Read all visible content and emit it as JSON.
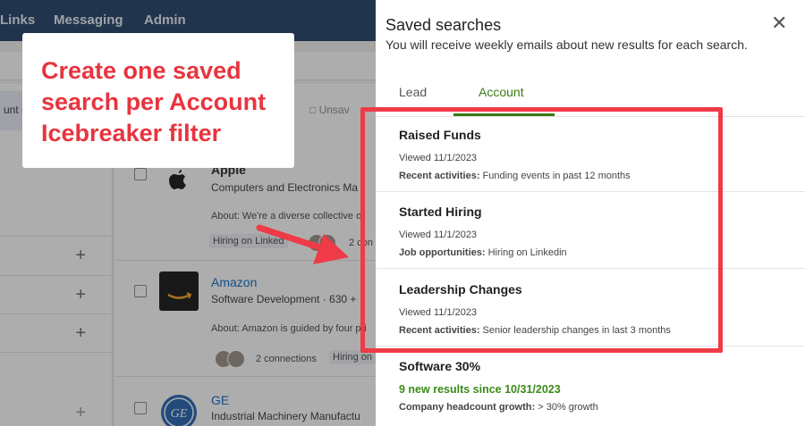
{
  "nav": {
    "items": [
      "Links",
      "Messaging",
      "Admin"
    ]
  },
  "background": {
    "unsave_label": "Unsav",
    "left_chip": "unt n",
    "companies": [
      {
        "name": "Apple",
        "industry": "Computers and Electronics Ma",
        "about": "About: We're a diverse collective of",
        "tag": "Hiring on Linked",
        "connections": "2 con"
      },
      {
        "name": "Amazon",
        "industry": "Software Development · 630 +",
        "about": "About: Amazon is guided by four pri",
        "tag": "Hiring on",
        "connections": "2 connections"
      },
      {
        "name": "GE",
        "industry": "Industrial Machinery Manufactu"
      }
    ]
  },
  "callout": {
    "lines": [
      "Create one saved",
      "search per Account",
      "Icebreaker filter"
    ]
  },
  "panel": {
    "title": "Saved searches",
    "subtitle": "You will receive weekly emails about new results for each search.",
    "close_label": "✕",
    "tabs": {
      "lead": "Lead",
      "account": "Account"
    },
    "searches": [
      {
        "title": "Raised Funds",
        "viewed": "Viewed 11/1/2023",
        "detail_label": "Recent activities:",
        "detail_value": " Funding events in past 12 months"
      },
      {
        "title": "Started Hiring",
        "viewed": "Viewed 11/1/2023",
        "detail_label": "Job opportunities:",
        "detail_value": " Hiring on Linkedin"
      },
      {
        "title": "Leadership Changes",
        "viewed": "Viewed 11/1/2023",
        "detail_label": "Recent activities:",
        "detail_value": " Senior leadership changes in last 3 months"
      },
      {
        "title": "Software 30%",
        "new_results": "9 new results since 10/31/2023",
        "detail_label": "Company headcount growth:",
        "detail_value": " > 30% growth"
      }
    ]
  },
  "colors": {
    "accent_green": "#3a7d14",
    "callout_red": "#e8343e",
    "highlight_red": "#ef3a47",
    "nav_blue": "#1d3d64"
  }
}
